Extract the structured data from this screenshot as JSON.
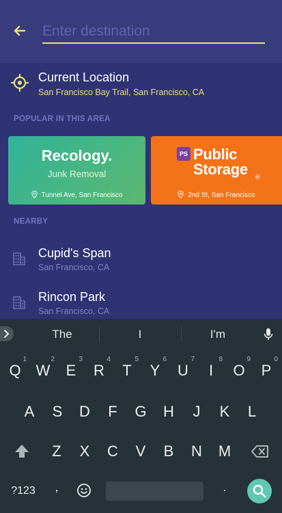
{
  "header": {
    "placeholder": "Enter destination"
  },
  "current_location": {
    "title": "Current Location",
    "subtitle": "San Francisco Bay Trail, San Francisco, CA"
  },
  "popular": {
    "section_label": "POPULAR IN THIS AREA",
    "cards": [
      {
        "brand": "Recology.",
        "tagline": "Junk Removal",
        "location": "Tunnel Ave, San Francisco"
      },
      {
        "brand_line1": "Public",
        "brand_line2": "Storage",
        "badge": "PS",
        "registered": "®",
        "location": "2nd St, San Francisco"
      }
    ]
  },
  "nearby": {
    "section_label": "NEARBY",
    "items": [
      {
        "title": "Cupid's Span",
        "subtitle": "San Francisco, CA"
      },
      {
        "title": "Rincon Park",
        "subtitle": "San Francisco, CA"
      }
    ]
  },
  "keyboard": {
    "suggestions": [
      "The",
      "I",
      "I'm"
    ],
    "row1": [
      "Q",
      "W",
      "E",
      "R",
      "T",
      "Y",
      "U",
      "I",
      "O",
      "P"
    ],
    "row1_nums": [
      "1",
      "2",
      "3",
      "4",
      "5",
      "6",
      "7",
      "8",
      "9",
      "0"
    ],
    "row2": [
      "A",
      "S",
      "D",
      "F",
      "G",
      "H",
      "J",
      "K",
      "L"
    ],
    "row3": [
      "Z",
      "X",
      "C",
      "V",
      "B",
      "N",
      "M"
    ],
    "symbols_label": "?123",
    "comma": ",",
    "period": "."
  },
  "colors": {
    "header_bg": "#383c7d",
    "page_bg": "#2f3374",
    "accent_yellow": "#e8e27a",
    "keyboard_bg": "#263238",
    "search_key": "#5fc8b1"
  }
}
